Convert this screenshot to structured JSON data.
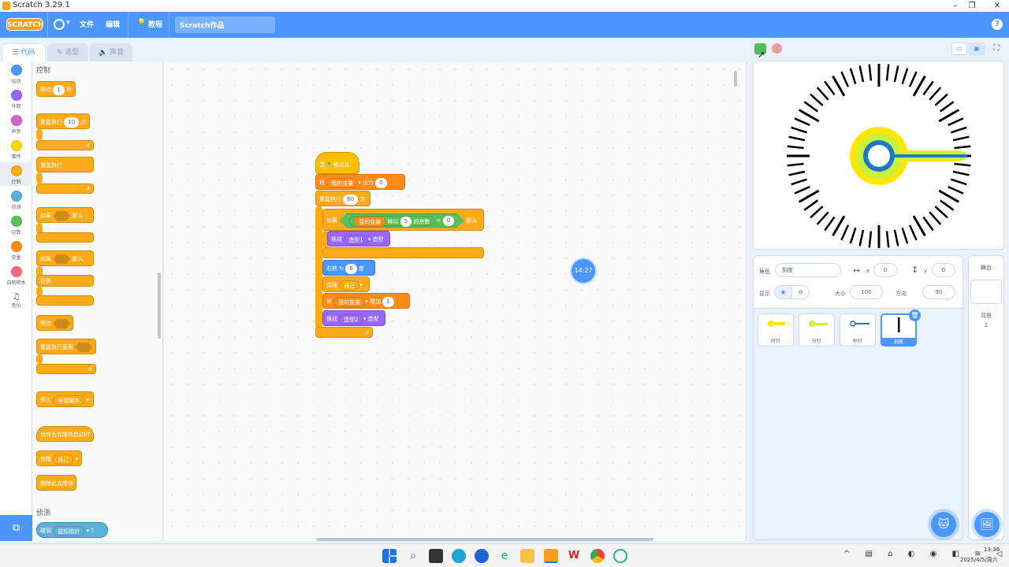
{
  "window": {
    "title": "Scratch 3.29.1",
    "min": "–",
    "max": "❐",
    "close": "✕"
  },
  "menu": {
    "logo": "SCRATCH",
    "file": "文件",
    "edit": "编辑",
    "tutorial": "教程",
    "project_name": "Scratch作品",
    "help": "?"
  },
  "tabs": {
    "code": "代码",
    "costumes": "造型",
    "sounds": "声音"
  },
  "categories": [
    {
      "label": "运动",
      "color": "#4c97ff"
    },
    {
      "label": "外观",
      "color": "#9966ff"
    },
    {
      "label": "声音",
      "color": "#cf63cf"
    },
    {
      "label": "事件",
      "color": "#ffd500"
    },
    {
      "label": "控制",
      "color": "#ffab19"
    },
    {
      "label": "侦测",
      "color": "#5cb1d6"
    },
    {
      "label": "运算",
      "color": "#59c059"
    },
    {
      "label": "变量",
      "color": "#ff8c1a"
    },
    {
      "label": "自制积木",
      "color": "#ff6680"
    },
    {
      "label": "音乐",
      "color": ""
    }
  ],
  "palette": {
    "heading_control": "控制",
    "wait": "等待",
    "wait_val": "1",
    "wait_unit": "秒",
    "repeat": "重复执行",
    "repeat_val": "10",
    "repeat_unit": "次",
    "forever": "重复执行",
    "if": "如果",
    "then": "那么",
    "if2": "如果",
    "then2": "那么",
    "else": "否则",
    "wait_until": "等待",
    "repeat_until": "重复执行直到",
    "stop": "停止",
    "stop_opt": "全部脚本",
    "clone_start": "当作为克隆体启动时",
    "clone": "克隆",
    "clone_opt": "自己",
    "delete_clone": "删除此克隆体",
    "heading_sensing": "侦测",
    "touching": "碰到",
    "touching_opt": "鼠标指针",
    "touching_q": "?"
  },
  "script": {
    "hat": "当",
    "hat_clicked": "被点击",
    "set": "将",
    "set_var": "我的变量",
    "set_to": "设为",
    "set_val": "0",
    "repeat": "重复执行",
    "repeat_val": "60",
    "repeat_unit": "次",
    "if": "如果",
    "mod_var": "我的变量",
    "mod_div": "除以",
    "mod_val": "5",
    "mod_rem": "的余数",
    "eq": "=",
    "eq_val": "0",
    "then": "那么",
    "switch1": "换成",
    "switch1_opt": "造型1",
    "switch1_end": "造型",
    "turn": "右转",
    "turn_val": "6",
    "turn_unit": "度",
    "clone": "克隆",
    "clone_opt": "自己",
    "change": "将",
    "change_var": "我的变量",
    "change_by": "增加",
    "change_val": "1",
    "switch2": "换成",
    "switch2_opt": "造型2",
    "switch2_end": "造型"
  },
  "workspace": {
    "time_bubble": "14:27",
    "zoom_in": "+",
    "zoom_out": "−",
    "zoom_reset": "="
  },
  "sprite_info": {
    "sprite_label": "角色",
    "sprite_name": "刻度",
    "x_label": "x",
    "x": "0",
    "y_label": "y",
    "y": "0",
    "show_label": "显示",
    "size_label": "大小",
    "size": "100",
    "direction_label": "方向",
    "direction": "90"
  },
  "sprites": [
    {
      "name": "时针",
      "color": "#ffe600"
    },
    {
      "name": "分针",
      "color": "#c8f03c"
    },
    {
      "name": "秒针",
      "color": "#1e78c8"
    },
    {
      "name": "刻度",
      "color": "#000000"
    }
  ],
  "stage_panel": {
    "title": "舞台",
    "backdrop_label": "背景",
    "backdrop_count": "1"
  },
  "clock": {
    "ticks": 60
  },
  "taskbar": {
    "time": "13:36",
    "date": "2025/4/5/周六"
  }
}
